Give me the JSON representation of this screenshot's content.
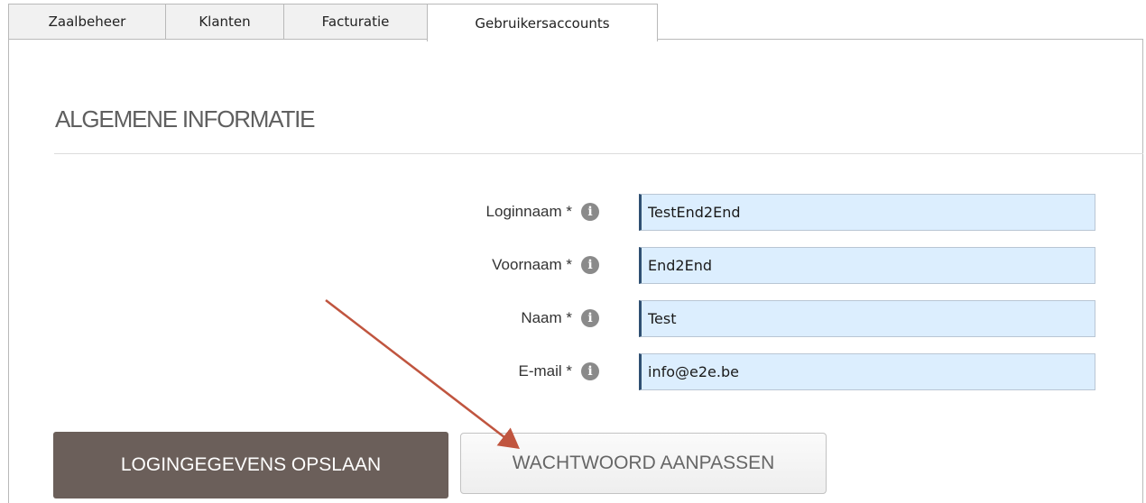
{
  "tabs": [
    {
      "label": "Zaalbeheer",
      "active": false
    },
    {
      "label": "Klanten",
      "active": false
    },
    {
      "label": "Facturatie",
      "active": false
    },
    {
      "label": "Gebruikersaccounts",
      "active": true
    }
  ],
  "section": {
    "title": "ALGEMENE INFORMATIE"
  },
  "form": {
    "fields": [
      {
        "label": "Loginnaam *",
        "value": "TestEnd2End",
        "icon": "info-icon"
      },
      {
        "label": "Voornaam *",
        "value": "End2End",
        "icon": "info-icon"
      },
      {
        "label": "Naam *",
        "value": "Test",
        "icon": "info-icon"
      },
      {
        "label": "E-mail *",
        "value": "info@e2e.be",
        "icon": "info-icon"
      }
    ],
    "info_glyph": "i"
  },
  "buttons": {
    "save_label": "LOGINGEGEVENS OPSLAAN",
    "change_password_label": "WACHTWOORD AANPASSEN"
  },
  "annotation": {
    "icon": "arrow-icon",
    "color": "#c0553f"
  },
  "colors": {
    "primary_button": "#6b5f5a",
    "input_background": "#dceefe",
    "input_accent": "#2f4f72"
  }
}
